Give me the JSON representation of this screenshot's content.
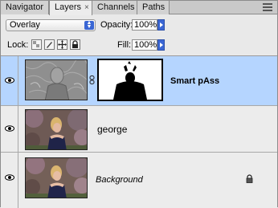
{
  "tabs": [
    {
      "label": "Navigator",
      "active": false
    },
    {
      "label": "Layers",
      "active": true
    },
    {
      "label": "Channels",
      "active": false
    },
    {
      "label": "Paths",
      "active": false
    }
  ],
  "tab_close_glyph": "×",
  "blend_mode": "Overlay",
  "opacity_label": "Opacity:",
  "opacity_value": "100%",
  "lock_label": "Lock:",
  "fill_label": "Fill:",
  "fill_value": "100%",
  "layers": [
    {
      "name": "Smart pAss",
      "selected": true,
      "visible": true,
      "has_mask": true
    },
    {
      "name": "george",
      "selected": false,
      "visible": true,
      "has_mask": false
    },
    {
      "name": "Background",
      "selected": false,
      "visible": true,
      "locked": true
    }
  ],
  "colors": {
    "selection": "#b5d5ff",
    "accent": "#3a66d4"
  }
}
